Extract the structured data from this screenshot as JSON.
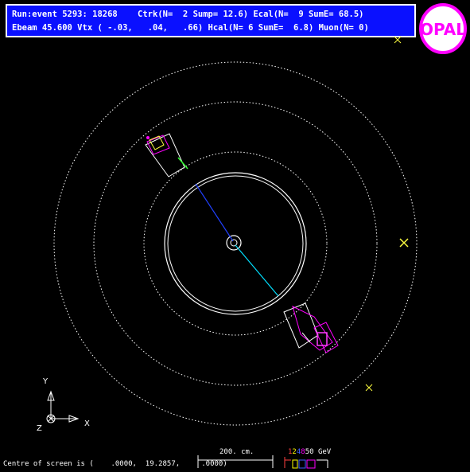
{
  "header": {
    "line1": "Run:event 5293: 18268    Ctrk(N=  2 Sump= 12.6) Ecal(N=  9 SumE= 68.5)",
    "line2": "Ebeam 45.600 Vtx ( -.03,   .04,   .66) Hcal(N= 6 SumE=  6.8) Muon(N= 0)"
  },
  "logo": {
    "text": "OPAL",
    "bg": "#ffffff",
    "ring": "#ff00ff"
  },
  "axes": {
    "y": "Y",
    "x": "X",
    "z": "Z"
  },
  "footer": {
    "centre": "Centre of screen is (    .0000,  19.2857,     .0000)",
    "scale_label": "200. cm.",
    "energy_ticks": [
      "1",
      "2",
      "4",
      "8",
      "50 GeV"
    ],
    "energy_colors": [
      "#ff4040",
      "#ffff00",
      "#4060ff",
      "#ff00ff",
      "#ffffff"
    ]
  },
  "colors": {
    "header_bg": "#0a10ff",
    "track_blue": "#2040ff",
    "track_cyan": "#00e0ff",
    "ecal_magenta": "#ff00ff",
    "muon_yellow": "#ffff40",
    "dotted": "#ffffff"
  }
}
